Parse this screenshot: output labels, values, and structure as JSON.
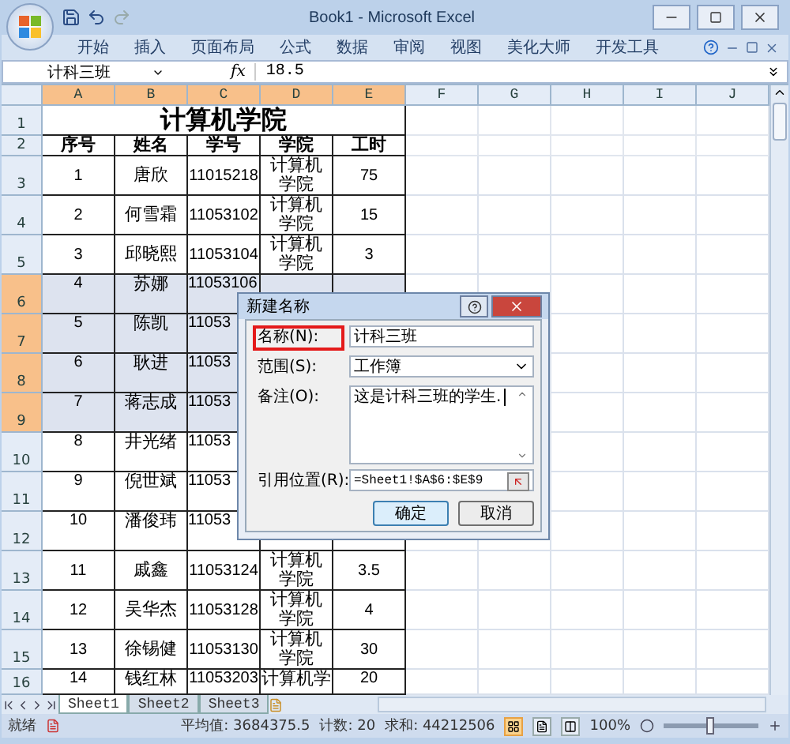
{
  "window": {
    "title": "Book1 - Microsoft Excel"
  },
  "ribbon_tabs": [
    "开始",
    "插入",
    "页面布局",
    "公式",
    "数据",
    "审阅",
    "视图",
    "美化大师",
    "开发工具"
  ],
  "formula_bar": {
    "name_box": "计科三班",
    "function_button": "fx",
    "formula": "18.5"
  },
  "columns": [
    {
      "label": "A",
      "selected": true
    },
    {
      "label": "B",
      "selected": true
    },
    {
      "label": "C",
      "selected": true
    },
    {
      "label": "D",
      "selected": true
    },
    {
      "label": "E",
      "selected": true
    },
    {
      "label": "F",
      "selected": false
    },
    {
      "label": "G",
      "selected": false
    },
    {
      "label": "H",
      "selected": false
    },
    {
      "label": "I",
      "selected": false
    },
    {
      "label": "J",
      "selected": false
    }
  ],
  "rows": [
    {
      "number": "1",
      "kind": "title",
      "selected": false,
      "cells": [
        "计算机学院"
      ]
    },
    {
      "number": "2",
      "kind": "header",
      "selected": false,
      "cells": [
        "序号",
        "姓名",
        "学号",
        "学院",
        "工时"
      ]
    },
    {
      "number": "3",
      "kind": "data",
      "selected": false,
      "cells": [
        "1",
        "唐欣",
        "11015218",
        "计算机学院",
        "75"
      ]
    },
    {
      "number": "4",
      "kind": "data",
      "selected": false,
      "cells": [
        "2",
        "何雪霜",
        "11053102",
        "计算机学院",
        "15"
      ]
    },
    {
      "number": "5",
      "kind": "data",
      "selected": false,
      "cells": [
        "3",
        "邱晓熙",
        "11053104",
        "计算机学院",
        "3"
      ]
    },
    {
      "number": "6",
      "kind": "partial",
      "selected": true,
      "cells": [
        "4",
        "苏娜",
        "11053106"
      ]
    },
    {
      "number": "7",
      "kind": "partial",
      "selected": true,
      "cells": [
        "5",
        "陈凯",
        "11053"
      ]
    },
    {
      "number": "8",
      "kind": "partial",
      "selected": true,
      "cells": [
        "6",
        "耿进",
        "11053"
      ]
    },
    {
      "number": "9",
      "kind": "partial",
      "selected": true,
      "cells": [
        "7",
        "蒋志成",
        "11053"
      ]
    },
    {
      "number": "10",
      "kind": "partial",
      "selected": false,
      "cells": [
        "8",
        "井光绪",
        "11053"
      ]
    },
    {
      "number": "11",
      "kind": "partial",
      "selected": false,
      "cells": [
        "9",
        "倪世斌",
        "11053"
      ]
    },
    {
      "number": "12",
      "kind": "partial",
      "selected": false,
      "cells": [
        "10",
        "潘俊玮",
        "11053"
      ]
    },
    {
      "number": "13",
      "kind": "data",
      "selected": false,
      "cells": [
        "11",
        "戚鑫",
        "11053124",
        "计算机学院",
        "3.5"
      ]
    },
    {
      "number": "14",
      "kind": "data",
      "selected": false,
      "cells": [
        "12",
        "吴华杰",
        "11053128",
        "计算机学院",
        "4"
      ]
    },
    {
      "number": "15",
      "kind": "data",
      "selected": false,
      "cells": [
        "13",
        "徐锡健",
        "11053130",
        "计算机学院",
        "30"
      ]
    },
    {
      "number": "16",
      "kind": "partial",
      "selected": false,
      "cells": [
        "14",
        "钱红林",
        "11053203",
        "计算机学",
        "20"
      ]
    }
  ],
  "dialog": {
    "title": "新建名称",
    "fields": [
      {
        "kind": "text",
        "label": "名称(N):",
        "highlighted": true,
        "value": "计科三班"
      },
      {
        "kind": "select",
        "label": "范围(S):",
        "highlighted": false,
        "value": "工作簿"
      },
      {
        "kind": "textarea",
        "label": "备注(O):",
        "highlighted": false,
        "value": "这是计科三班的学生."
      },
      {
        "kind": "reference",
        "label": "引用位置(R):",
        "highlighted": false,
        "value": "=Sheet1!$A$6:$E$9"
      }
    ],
    "buttons": [
      {
        "label": "确定",
        "default": true
      },
      {
        "label": "取消",
        "default": false
      }
    ]
  },
  "sheet_tabs": [
    {
      "label": "Sheet1",
      "selected": true
    },
    {
      "label": "Sheet2",
      "selected": false
    },
    {
      "label": "Sheet3",
      "selected": false
    }
  ],
  "status_bar": {
    "status": "就绪",
    "stats": [
      "平均值: 3684375.5",
      "计数: 20",
      "求和: 44212506"
    ],
    "views": [
      {
        "selected": true
      },
      {
        "selected": false
      },
      {
        "selected": false
      }
    ],
    "zoom": "100%",
    "zoom_slider": {
      "level": 0.5
    }
  }
}
